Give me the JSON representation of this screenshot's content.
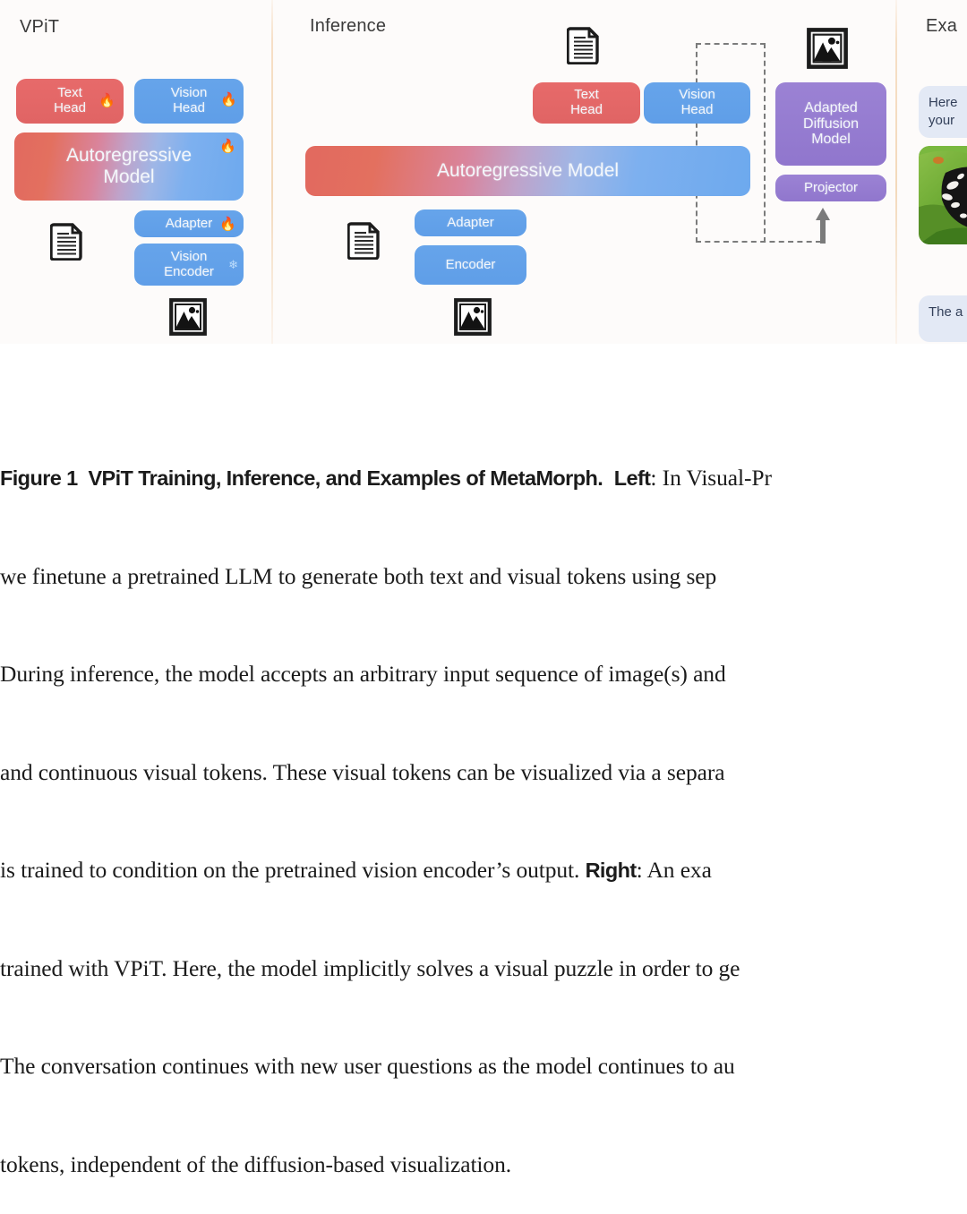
{
  "figure": {
    "left_panel": {
      "title": "VPiT",
      "blocks": [
        {
          "id": "text-head",
          "label": "Text\nHead",
          "marker": "flame"
        },
        {
          "id": "vision-head",
          "label": "Vision\nHead",
          "marker": "flame"
        },
        {
          "id": "autoregressive",
          "label": "Autoregressive\nModel",
          "marker": "flame"
        },
        {
          "id": "adapter",
          "label": "Adapter",
          "marker": "flame"
        },
        {
          "id": "vision-encoder",
          "label": "Vision\nEncoder",
          "marker": "snowflake"
        }
      ],
      "icons": [
        "document-icon",
        "image-icon"
      ],
      "markers": {
        "flame": "🔥",
        "snowflake": "❄"
      }
    },
    "middle_panel": {
      "title": "Inference",
      "blocks": [
        {
          "id": "text-head",
          "label": "Text\nHead"
        },
        {
          "id": "vision-head",
          "label": "Vision\nHead"
        },
        {
          "id": "autoregressive",
          "label": "Autoregressive Model"
        },
        {
          "id": "adapter",
          "label": "Adapter"
        },
        {
          "id": "encoder",
          "label": "Encoder"
        },
        {
          "id": "adapted-diffusion",
          "label": "Adapted\nDiffusion\nModel"
        },
        {
          "id": "projector",
          "label": "Projector"
        }
      ],
      "icons": [
        "document-icon-top",
        "document-icon-left",
        "image-icon-bottom",
        "image-icon-output"
      ]
    },
    "right_panel": {
      "title": "Exa",
      "bubbles": [
        {
          "id": "bubble-1",
          "text": "Here\nyour"
        },
        {
          "id": "bubble-2",
          "text": "The a"
        }
      ],
      "photo_alt": "butterfly-photo"
    },
    "colors": {
      "red_block": "#e06464",
      "blue_block": "#5f9ee8",
      "purple_block": "#9076cd",
      "divider": "#f3d9bb",
      "bubble": "#e3e9f5",
      "panel_background": "#fdfbfa"
    }
  },
  "caption": {
    "label": "Figure 1",
    "bold_title": "VPiT Training, Inference, and Examples of MetaMorph.",
    "lines": [
      {
        "bold_head": "Figure 1  VPiT Training, Inference, and Examples of MetaMorph.",
        "bold_tail": "Left",
        "rest": ": In Visual-Pr"
      },
      {
        "rest": "we finetune a pretrained LLM to generate both text and visual tokens using sep"
      },
      {
        "rest": "During inference, the model accepts an arbitrary input sequence of image(s) and"
      },
      {
        "rest": "and continuous visual tokens. These visual tokens can be visualized via a separa"
      },
      {
        "rest_pre": "is trained to condition on the pretrained vision encoder’s output. ",
        "bold_tail": "Right",
        "rest": ": An exa"
      },
      {
        "rest": "trained with VPiT. Here, the model implicitly solves a visual puzzle in order to ge"
      },
      {
        "rest": "The conversation continues with new user questions as the model continues to au"
      },
      {
        "rest": "tokens, independent of the diffusion-based visualization."
      }
    ]
  }
}
